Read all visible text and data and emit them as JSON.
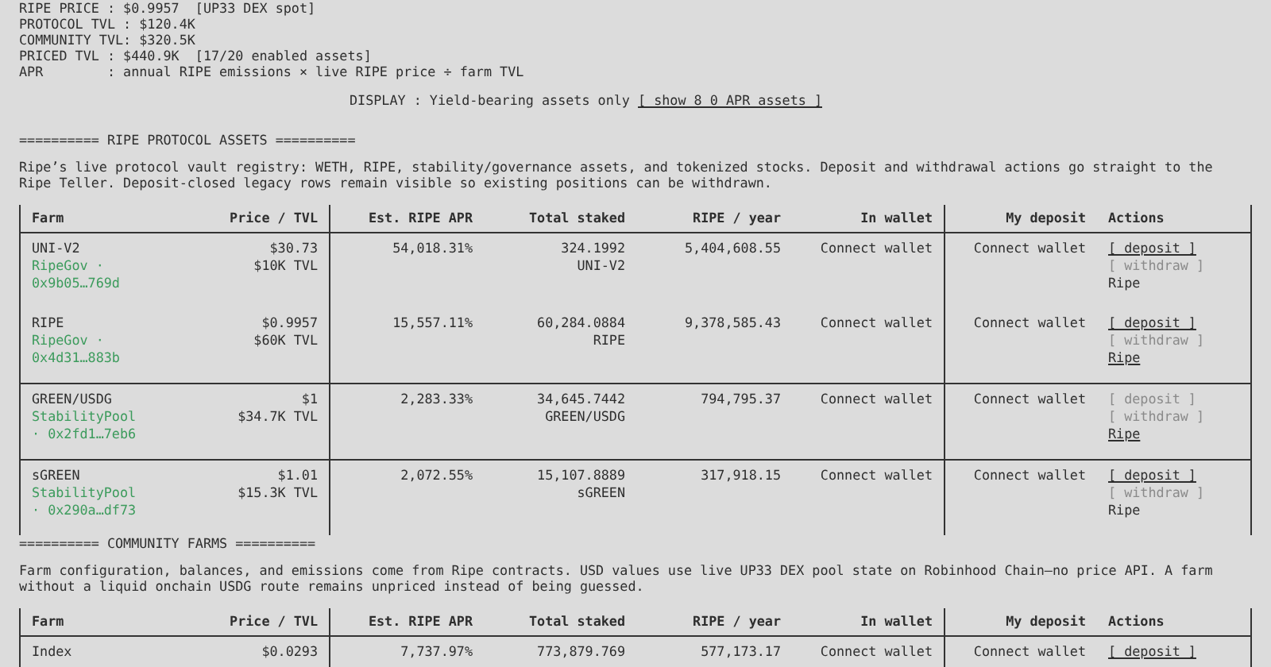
{
  "stats": [
    "RIPE PRICE : $0.9957  [UP33 DEX spot]",
    "PROTOCOL TVL : $120.4K",
    "COMMUNITY TVL: $320.5K",
    "PRICED TVL : $440.9K  [17/20 enabled assets]",
    "APR        : annual RIPE emissions × live RIPE price ÷ farm TVL"
  ],
  "display": {
    "label": "DISPLAY : Yield-bearing assets only",
    "toggle": "[ show 8 0 APR assets ]"
  },
  "sections": [
    {
      "heading": "========== RIPE PROTOCOL ASSETS ==========",
      "description": "Ripe’s live protocol vault registry: WETH, RIPE, stability/governance assets, and tokenized stocks. Deposit and withdrawal actions go straight to the Ripe Teller. Deposit-closed legacy rows remain visible so existing positions can be withdrawn.",
      "table": {
        "columns": [
          "Farm",
          "Price / TVL",
          "Est. RIPE APR",
          "Total staked",
          "RIPE / year",
          "In wallet",
          "My deposit",
          "Actions"
        ],
        "groups": [
          {
            "rows": [
              {
                "farm": "UNI-V2",
                "vault": "RipeGov · 0x9b05…769d",
                "price": "$30.73",
                "tvl": "$10K TVL",
                "apr": "54,018.31%",
                "staked": "324.1992",
                "unit": "UNI-V2",
                "per_year": "5,404,608.55",
                "wallet": "Connect wallet",
                "deposit_balance": "Connect wallet",
                "actions": {
                  "deposit": {
                    "label": "[ deposit ]",
                    "enabled": true
                  },
                  "withdraw": {
                    "label": "[ withdraw ]",
                    "enabled": false
                  },
                  "source": {
                    "label": "Ripe",
                    "linked": false
                  }
                }
              },
              {
                "farm": "RIPE",
                "vault": "RipeGov · 0x4d31…883b",
                "price": "$0.9957",
                "tvl": "$60K TVL",
                "apr": "15,557.11%",
                "staked": "60,284.0884",
                "unit": "RIPE",
                "per_year": "9,378,585.43",
                "wallet": "Connect wallet",
                "deposit_balance": "Connect wallet",
                "actions": {
                  "deposit": {
                    "label": "[ deposit ]",
                    "enabled": true
                  },
                  "withdraw": {
                    "label": "[ withdraw ]",
                    "enabled": false
                  },
                  "source": {
                    "label": "Ripe",
                    "linked": true
                  }
                }
              }
            ]
          },
          {
            "rows": [
              {
                "farm": "GREEN/USDG",
                "vault": "StabilityPool · 0x2fd1…7eb6",
                "price": "$1",
                "tvl": "$34.7K TVL",
                "apr": "2,283.33%",
                "staked": "34,645.7442",
                "unit": "GREEN/USDG",
                "per_year": "794,795.37",
                "wallet": "Connect wallet",
                "deposit_balance": "Connect wallet",
                "actions": {
                  "deposit": {
                    "label": "[ deposit ]",
                    "enabled": false
                  },
                  "withdraw": {
                    "label": "[ withdraw ]",
                    "enabled": false
                  },
                  "source": {
                    "label": "Ripe",
                    "linked": true
                  }
                }
              }
            ]
          },
          {
            "rows": [
              {
                "farm": "sGREEN",
                "vault": "StabilityPool · 0x290a…df73",
                "price": "$1.01",
                "tvl": "$15.3K TVL",
                "apr": "2,072.55%",
                "staked": "15,107.8889",
                "unit": "sGREEN",
                "per_year": "317,918.15",
                "wallet": "Connect wallet",
                "deposit_balance": "Connect wallet",
                "actions": {
                  "deposit": {
                    "label": "[ deposit ]",
                    "enabled": true
                  },
                  "withdraw": {
                    "label": "[ withdraw ]",
                    "enabled": false
                  },
                  "source": {
                    "label": "Ripe",
                    "linked": false
                  }
                }
              }
            ]
          }
        ]
      }
    },
    {
      "heading": "========== COMMUNITY FARMS ==========",
      "description": "Farm configuration, balances, and emissions come from Ripe contracts. USD values use live UP33 DEX pool state on Robinhood Chain—no price API. A farm without a liquid onchain USDG route remains unpriced instead of being guessed.",
      "table": {
        "columns": [
          "Farm",
          "Price / TVL",
          "Est. RIPE APR",
          "Total staked",
          "RIPE / year",
          "In wallet",
          "My deposit",
          "Actions"
        ],
        "groups": [
          {
            "rows": [
              {
                "farm": "Index",
                "price": "$0.0293",
                "apr": "7,737.97%",
                "staked": "773,879.769",
                "per_year": "577,173.17",
                "wallet": "Connect wallet",
                "deposit_balance": "Connect wallet",
                "actions": {
                  "deposit": {
                    "label": "[ deposit ]",
                    "enabled": true
                  }
                }
              }
            ]
          }
        ]
      }
    }
  ]
}
